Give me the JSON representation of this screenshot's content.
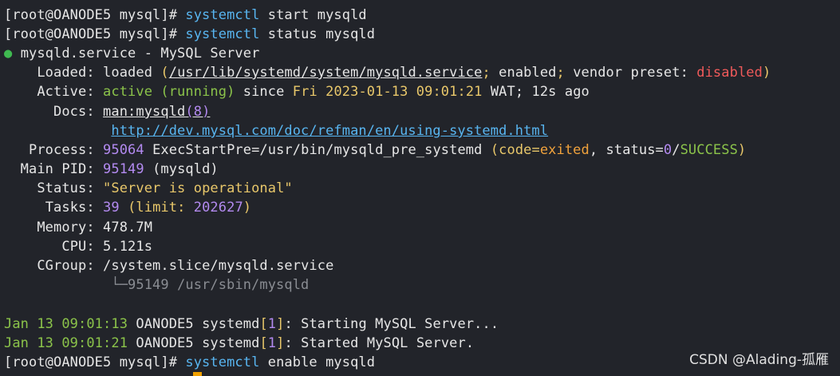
{
  "terminal": {
    "prompt": "[root@OANODE5 mysql]#",
    "cmd1": {
      "tool": "systemctl",
      "args": "start mysqld"
    },
    "cmd2": {
      "tool": "systemctl",
      "args": "status mysqld"
    },
    "service": {
      "dot": "●",
      "title": "mysqld.service - MySQL Server",
      "loaded_label": "Loaded:",
      "loaded_state": "loaded",
      "loaded_path": "/usr/lib/systemd/system/mysqld.service",
      "enabled": "enabled",
      "vendor_preset_label": "vendor preset:",
      "vendor_preset": "disabled",
      "active_label": "Active:",
      "active_state": "active (running)",
      "since_label": "since",
      "since_time": "Fri 2023-01-13 09:01:21",
      "tz": "WAT;",
      "ago": "12s ago",
      "docs_label": "Docs:",
      "docs_man_prefix": "man:mysqld",
      "docs_man_section": "(8)",
      "docs_url": "http://dev.mysql.com/doc/refman/en/using-systemd.html",
      "process_label": "Process:",
      "process_pid": "95064",
      "process_cmd": "ExecStartPre=/usr/bin/mysqld_pre_systemd",
      "process_code_label": "(code=",
      "process_code": "exited",
      "process_status_label": ", status=",
      "process_status_num": "0",
      "process_status_word": "SUCCESS",
      "mainpid_label": "Main PID:",
      "mainpid_value": "95149",
      "mainpid_name": "(mysqld)",
      "status_label": "Status:",
      "status_value": "\"Server is operational\"",
      "tasks_label": "Tasks:",
      "tasks_value": "39",
      "tasks_limit_label": "(limit:",
      "tasks_limit": "202627",
      "memory_label": "Memory:",
      "memory_value": "478.7M",
      "cpu_label": "CPU:",
      "cpu_value": "5.121s",
      "cgroup_label": "CGroup:",
      "cgroup_value": "/system.slice/mysqld.service",
      "cgroup_tree": "└─95149 /usr/sbin/mysqld"
    },
    "log": [
      {
        "time": "Jan 13 09:01:13",
        "host": "OANODE5",
        "unit": "systemd",
        "pid": "1",
        "msg": "Starting MySQL Server..."
      },
      {
        "time": "Jan 13 09:01:21",
        "host": "OANODE5",
        "unit": "systemd",
        "pid": "1",
        "msg": "Started MySQL Server."
      }
    ],
    "cmd3": {
      "tool": "systemctl",
      "args": "enable mysqld"
    }
  },
  "watermark": "CSDN @Alading-孤雁",
  "colors": {
    "background": "#22242a",
    "command": "#58b5f0",
    "green": "#8bc34a",
    "yellow": "#e8c76a",
    "orange": "#f0a23c",
    "red": "#f05a5a",
    "purple": "#b38af0"
  }
}
